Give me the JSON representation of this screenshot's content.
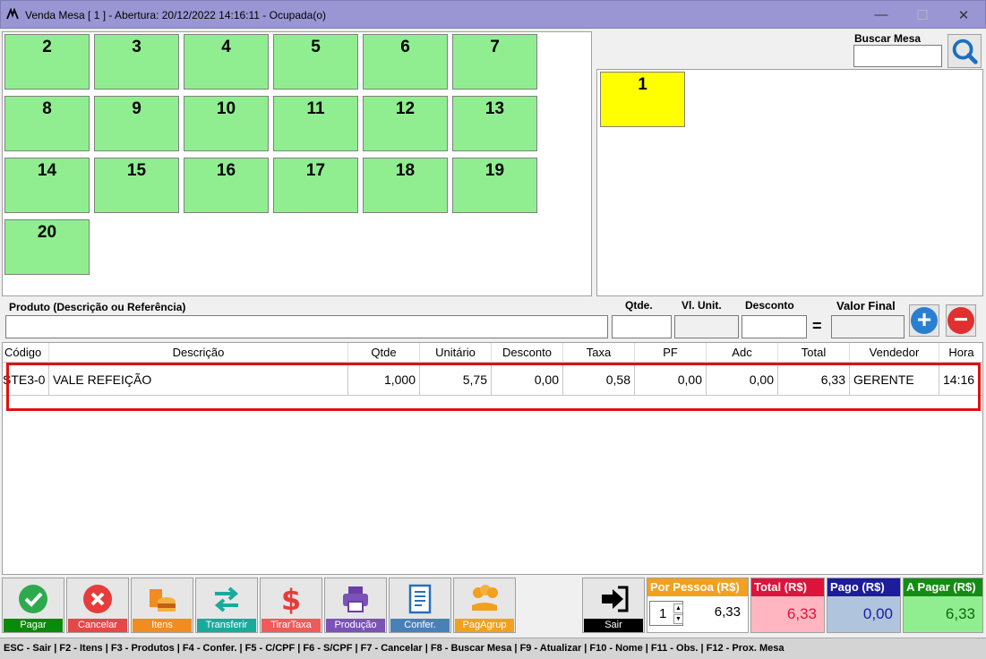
{
  "window": {
    "title": "Venda Mesa [ 1 ] - Abertura: 20/12/2022 14:16:11 - Ocupada(o)"
  },
  "mesas": [
    "2",
    "3",
    "4",
    "5",
    "6",
    "7",
    "8",
    "9",
    "10",
    "11",
    "12",
    "13",
    "14",
    "15",
    "16",
    "17",
    "18",
    "19",
    "20"
  ],
  "selected_mesa": "1",
  "search": {
    "label": "Buscar Mesa",
    "value": ""
  },
  "product_entry": {
    "produto_label": "Produto (Descrição ou Referência)",
    "qtde_label": "Qtde.",
    "vl_unit_label": "Vl. Unit.",
    "desconto_label": "Desconto",
    "valor_final_label": "Valor Final",
    "equals": "=",
    "plus": "+",
    "minus": "−"
  },
  "table": {
    "columns": [
      "Código",
      "Descrição",
      "Qtde",
      "Unitário",
      "Desconto",
      "Taxa",
      "PF",
      "Adc",
      "Total",
      "Vendedor",
      "Hora"
    ],
    "rows": [
      {
        "codigo": "STE3-0",
        "descricao": "VALE REFEIÇÃO",
        "qtde": "1,000",
        "unitario": "5,75",
        "desconto": "0,00",
        "taxa": "0,58",
        "pf": "0,00",
        "adc": "0,00",
        "total": "6,33",
        "vendedor": "GERENTE",
        "hora": "14:16"
      }
    ]
  },
  "actions": [
    {
      "label": "Pagar",
      "color": "#0a8a0a",
      "icon": "check-icon"
    },
    {
      "label": "Cancelar",
      "color": "#e44848",
      "icon": "cancel-icon"
    },
    {
      "label": "Itens",
      "color": "#f28c1e",
      "icon": "food-icon"
    },
    {
      "label": "Transferir",
      "color": "#1aaa9c",
      "icon": "transfer-icon"
    },
    {
      "label": "TirarTaxa",
      "color": "#f05a5a",
      "icon": "dollar-icon"
    },
    {
      "label": "Produção",
      "color": "#7b52b8",
      "icon": "printer-icon"
    },
    {
      "label": "Confer.",
      "color": "#4a80b8",
      "icon": "document-icon"
    },
    {
      "label": "PagAgrup",
      "color": "#f2a020",
      "icon": "money-hand-icon"
    },
    {
      "label": "Sair",
      "color": "#000000",
      "icon": "exit-icon"
    }
  ],
  "totals": {
    "por_pessoa": {
      "label": "Por Pessoa (R$)",
      "people": "1",
      "value": "6,33"
    },
    "total": {
      "label": "Total (R$)",
      "value": "6,33"
    },
    "pago": {
      "label": "Pago (R$)",
      "value": "0,00"
    },
    "a_pagar": {
      "label": "A Pagar (R$)",
      "value": "6,33"
    }
  },
  "statusbar": "ESC - Sair  | F2 - Itens  | F3 - Produtos |  F4 - Confer.  |  F5 - C/CPF  |  F6 - S/CPF  | F7 - Cancelar  | F8 - Buscar Mesa  |  F9 - Atualizar  | F10 - Nome  | F11 - Obs.  | F12 - Prox. Mesa"
}
